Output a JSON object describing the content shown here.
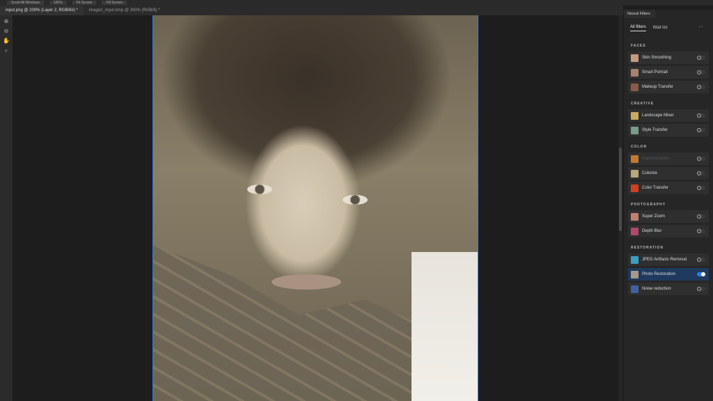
{
  "topbar": {
    "buttons": [
      "Scroll All Windows",
      "100%",
      "Fit Screen",
      "Fill Screen"
    ]
  },
  "tabs": [
    {
      "label": "input.png @ 200% (Layer 2, RGB/8#) *"
    },
    {
      "label": "image2_input.bmp @ 300% (RGB/8) *"
    }
  ],
  "tools": [
    "zoom-in",
    "zoom-out",
    "hand",
    "search"
  ],
  "panel": {
    "title": "Neural Filters",
    "tabs": [
      "All filters",
      "Wait list"
    ],
    "more": "···",
    "sections": [
      {
        "title": "FACES",
        "items": [
          {
            "label": "Skin Smoothing",
            "on": false,
            "color": "#c49a80"
          },
          {
            "label": "Smart Portrait",
            "on": false,
            "color": "#a88070"
          },
          {
            "label": "Makeup Transfer",
            "on": false,
            "color": "#8a5a48"
          }
        ]
      },
      {
        "title": "CREATIVE",
        "items": [
          {
            "label": "Landscape Mixer",
            "on": false,
            "color": "#c9a860"
          },
          {
            "label": "Style Transfer",
            "on": false,
            "color": "#7a9a8a"
          }
        ]
      },
      {
        "title": "COLOR",
        "items": [
          {
            "label": "Harmonization",
            "on": false,
            "disabled": true,
            "color": "#c07a30"
          },
          {
            "label": "Colorize",
            "on": false,
            "color": "#b8a878"
          },
          {
            "label": "Color Transfer",
            "on": false,
            "color": "#d04020"
          }
        ]
      },
      {
        "title": "PHOTOGRAPHY",
        "items": [
          {
            "label": "Super Zoom",
            "on": false,
            "color": "#c08070"
          },
          {
            "label": "Depth Blur",
            "on": false,
            "color": "#b04870"
          }
        ]
      },
      {
        "title": "RESTORATION",
        "items": [
          {
            "label": "JPEG Artifacts Removal",
            "on": false,
            "color": "#3aa0c0"
          },
          {
            "label": "Photo Restoration",
            "on": true,
            "selected": true,
            "color": "#a89888"
          },
          {
            "label": "Noise reduction",
            "on": false,
            "color": "#4060a0"
          }
        ]
      }
    ]
  }
}
